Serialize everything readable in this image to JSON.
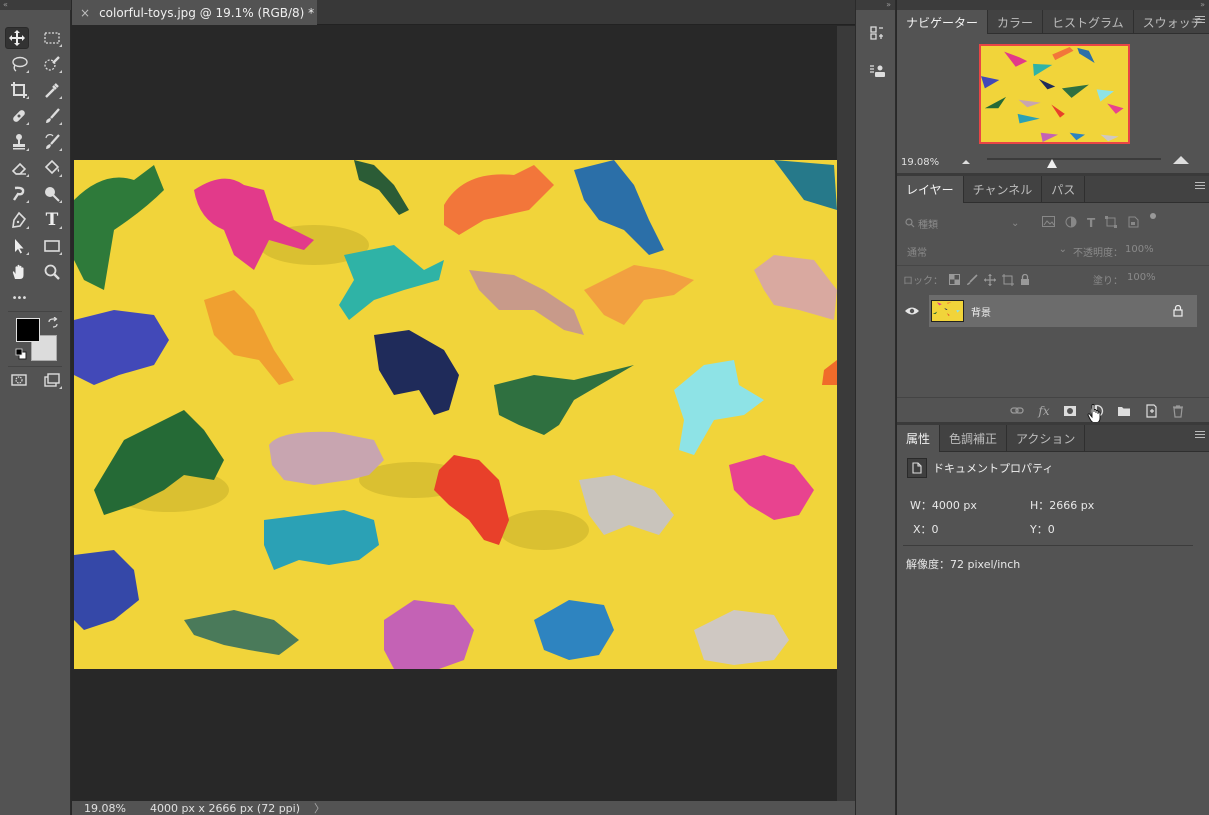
{
  "document": {
    "tab_title": "colorful-toys.jpg @ 19.1% (RGB/8) *",
    "close_glyph": "×",
    "status_zoom": "19.08%",
    "status_info": "4000 px x 2666 px (72 ppi)",
    "status_arrow": "〉"
  },
  "toolbar": {
    "tools": [
      {
        "name": "move-tool",
        "icon": "move-icon"
      },
      {
        "name": "marquee-tool",
        "icon": "rect-marquee-icon"
      },
      {
        "name": "lasso-tool",
        "icon": "lasso-icon"
      },
      {
        "name": "quick-select-tool",
        "icon": "quick-select-icon"
      },
      {
        "name": "crop-tool",
        "icon": "crop-icon"
      },
      {
        "name": "eyedropper-tool",
        "icon": "eyedropper-icon"
      },
      {
        "name": "healing-tool",
        "icon": "bandage-icon"
      },
      {
        "name": "brush-tool",
        "icon": "brush-icon"
      },
      {
        "name": "stamp-tool",
        "icon": "stamp-icon"
      },
      {
        "name": "history-brush-tool",
        "icon": "history-brush-icon"
      },
      {
        "name": "eraser-tool",
        "icon": "eraser-icon"
      },
      {
        "name": "bucket-tool",
        "icon": "bucket-icon"
      },
      {
        "name": "smudge-tool",
        "icon": "smudge-icon"
      },
      {
        "name": "dodge-tool",
        "icon": "dodge-icon"
      },
      {
        "name": "pen-tool",
        "icon": "pen-icon"
      },
      {
        "name": "type-tool",
        "icon": "type-icon"
      },
      {
        "name": "path-select-tool",
        "icon": "arrow-icon"
      },
      {
        "name": "shape-tool",
        "icon": "rectangle-icon"
      },
      {
        "name": "hand-tool",
        "icon": "hand-icon"
      },
      {
        "name": "zoom-tool",
        "icon": "magnifier-icon"
      }
    ],
    "type_glyph": "T",
    "more_glyph": "•••"
  },
  "navigator": {
    "tabs": [
      "ナビゲーター",
      "カラー",
      "ヒストグラム",
      "スウォッチ"
    ],
    "zoom": "19.08%"
  },
  "layers": {
    "tabs": [
      "レイヤー",
      "チャンネル",
      "パス"
    ],
    "filter_label": "種類",
    "blend_mode": "通常",
    "opacity_label": "不透明度：",
    "opacity_value": "100%",
    "lock_label": "ロック：",
    "fill_label": "塗り：",
    "fill_value": "100%",
    "layer_name": "背景",
    "fx_label": "fx"
  },
  "properties": {
    "tabs": [
      "属性",
      "色調補正",
      "アクション"
    ],
    "title": "ドキュメントプロパティ",
    "w_label": "W：4000 px",
    "h_label": "H：2666 px",
    "x_label": "X：0",
    "y_label": "Y：0",
    "resolution": "解像度：72 pixel/inch"
  },
  "colors": {
    "accent": "#e94545",
    "canvas_yellow": "#f1d43a",
    "panel": "#535353"
  }
}
